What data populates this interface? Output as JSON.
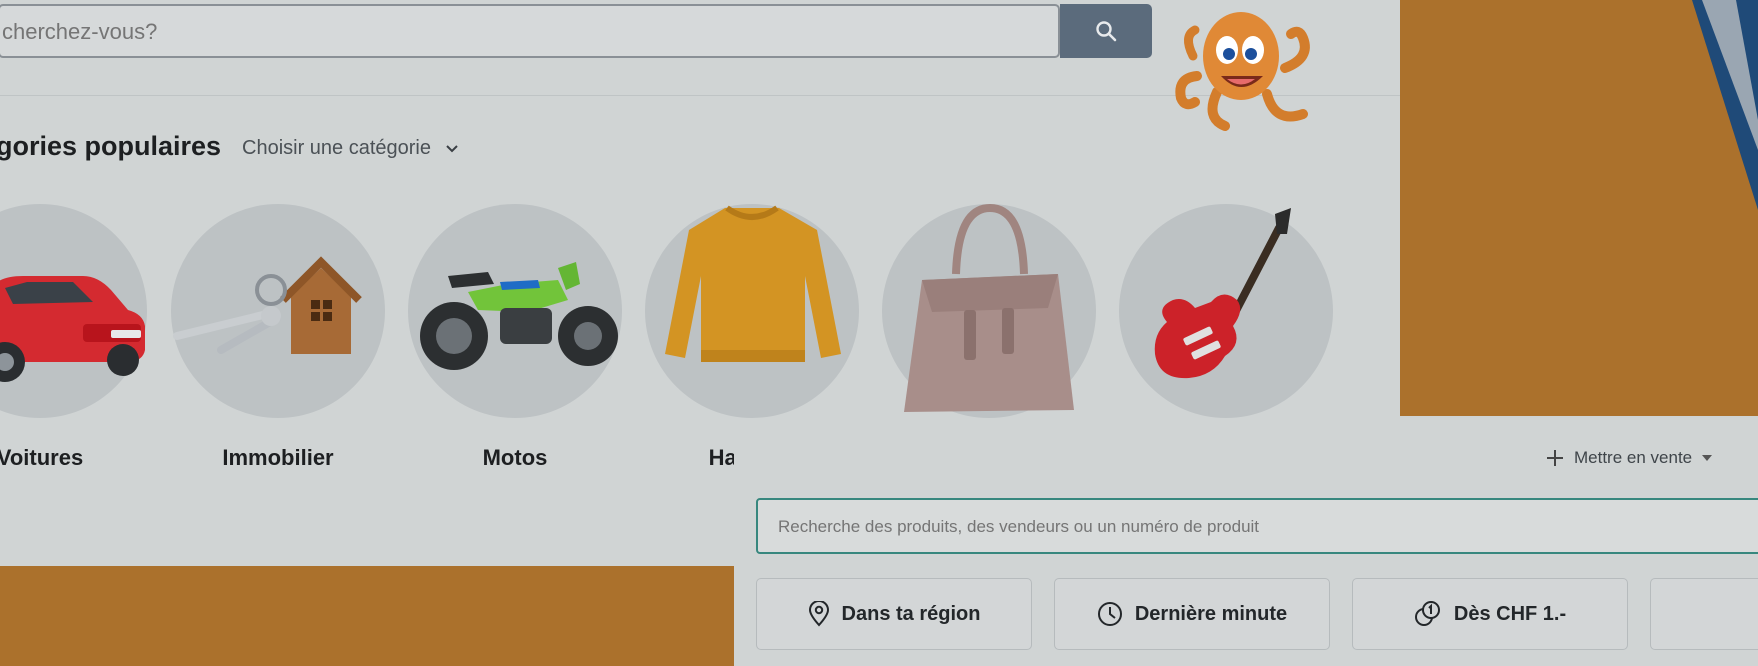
{
  "header": {
    "search_placeholder": "cherchez-vous?",
    "search_button_icon": "search-icon"
  },
  "categories_section": {
    "title": "gories populaires",
    "select_label": "Choisir une catégorie",
    "items": [
      {
        "label": "Voitures",
        "icon": "car-image"
      },
      {
        "label": "Immobilier",
        "icon": "keys-house-image"
      },
      {
        "label": "Motos",
        "icon": "motorcycle-image"
      },
      {
        "label": "Habits p",
        "icon": "sweater-image"
      },
      {
        "label": "",
        "icon": "handbag-image"
      },
      {
        "label": "",
        "icon": "guitar-image"
      }
    ]
  },
  "foreground": {
    "sell_label": "Mettre en vente",
    "search_placeholder": "Recherche des produits, des vendeurs ou un numéro de produit",
    "chips": [
      {
        "label": "Dans ta région",
        "icon": "location-pin-icon"
      },
      {
        "label": "Dernière minute",
        "icon": "clock-icon"
      },
      {
        "label": "Dès CHF 1.-",
        "icon": "coin-one-icon"
      },
      {
        "label": "",
        "icon": "heart-icon"
      }
    ]
  },
  "colors": {
    "accent_orange": "#ab712c",
    "search_button": "#5b6b7c",
    "search_border_active": "#37877e"
  }
}
